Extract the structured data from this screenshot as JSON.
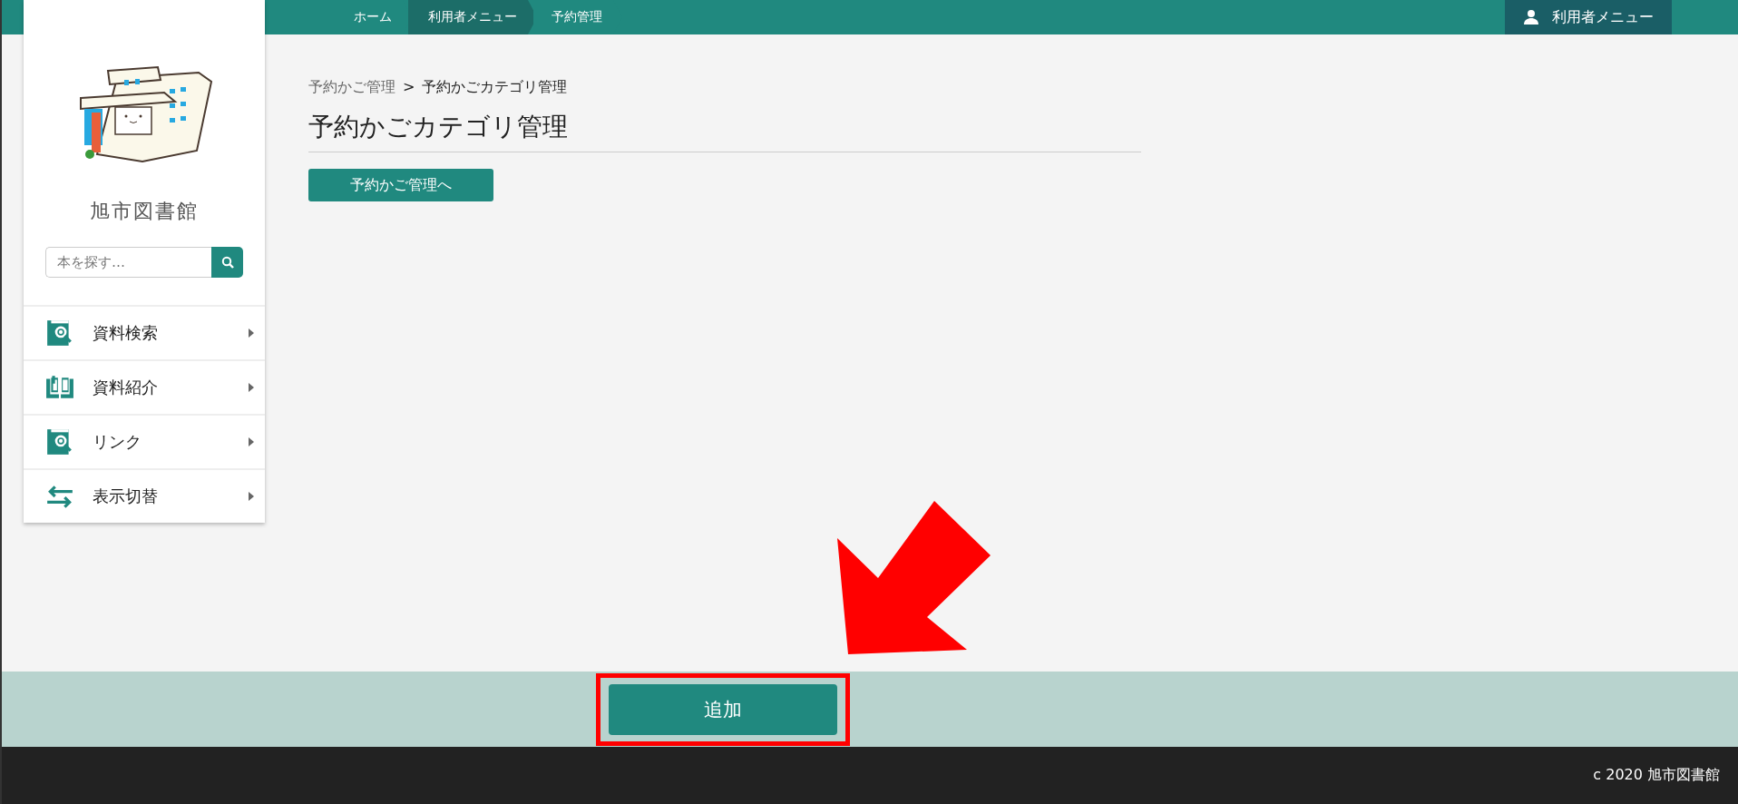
{
  "top_nav": {
    "breadcrumbs": [
      {
        "label": "ホーム",
        "selected": false
      },
      {
        "label": "利用者メニュー",
        "selected": true
      },
      {
        "label": "予約管理",
        "selected": false
      }
    ],
    "user_menu": "利用者メニュー"
  },
  "sidebar": {
    "library_name": "旭市図書館",
    "search": {
      "placeholder": "本を探す…"
    },
    "items": [
      {
        "label": "資料検索"
      },
      {
        "label": "資料紹介"
      },
      {
        "label": "リンク"
      },
      {
        "label": "表示切替"
      }
    ]
  },
  "breadcrumb": {
    "parent": "予約かご管理",
    "separator": ">",
    "current": "予約かごカテゴリ管理"
  },
  "title": "予約かごカテゴリ管理",
  "back_button": "予約かご管理へ",
  "action_bar": {
    "add_button": "追加"
  },
  "footer": "c 2020 旭市図書館"
}
